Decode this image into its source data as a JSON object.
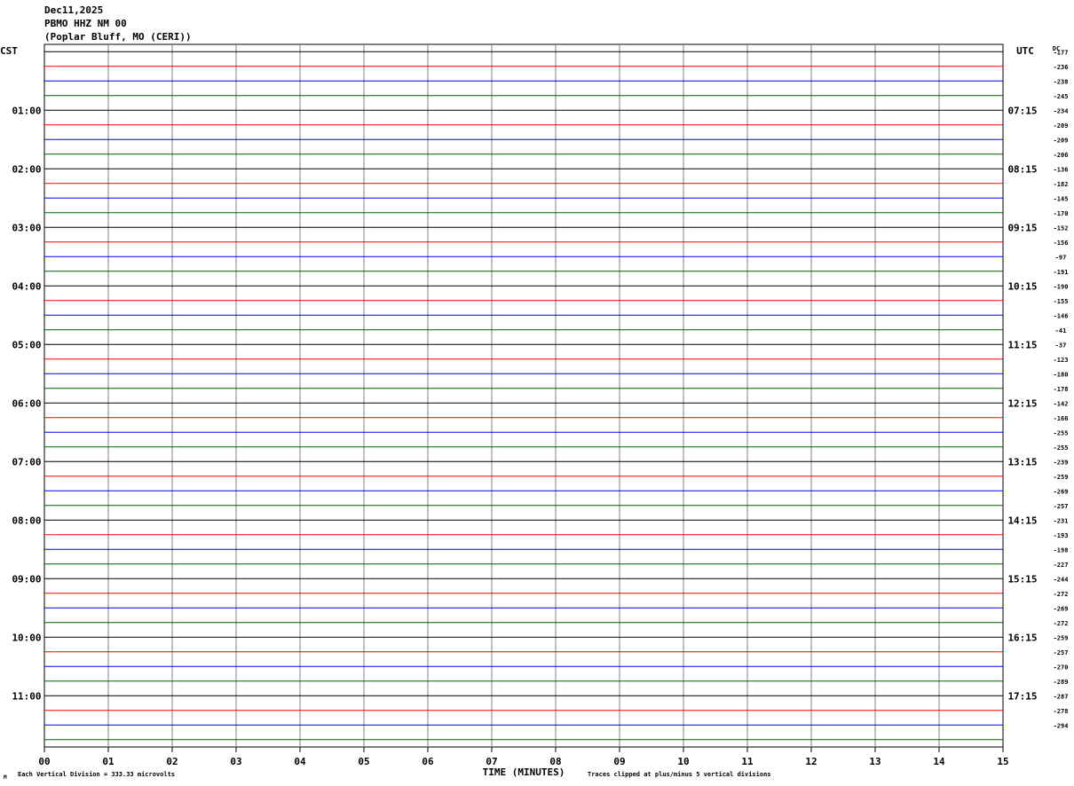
{
  "header": {
    "date": "Dec11,2025",
    "station": "PBMO HHZ NM 00",
    "location": "(Poplar Bluff, MO (CERI))"
  },
  "chart_data": {
    "type": "line",
    "title": "PBMO HHZ NM 00",
    "left_axis_title": "CST",
    "right_axis_title": "UTC",
    "dc_label": "DC",
    "xlabel": "TIME (MINUTES)",
    "x_ticks": [
      "00",
      "01",
      "02",
      "03",
      "04",
      "05",
      "06",
      "07",
      "08",
      "09",
      "10",
      "11",
      "12",
      "13",
      "14",
      "15"
    ],
    "xlim": [
      0,
      15
    ],
    "trace_count": 48,
    "trace_minutes": 15,
    "left_hour_labels": [
      "01:00",
      "02:00",
      "03:00",
      "04:00",
      "05:00",
      "06:00",
      "07:00",
      "08:00",
      "09:00",
      "10:00",
      "11:00"
    ],
    "right_hour_labels": [
      "07:15",
      "08:15",
      "09:15",
      "10:15",
      "11:15",
      "12:15",
      "13:15",
      "14:15",
      "15:15",
      "16:15",
      "17:15"
    ],
    "dc_offsets": [
      "-177",
      "-236",
      "-238",
      "-245",
      "-234",
      "-209",
      "-209",
      "-206",
      "-136",
      "-182",
      "-145",
      "-170",
      "-152",
      "-156",
      "-97",
      "-191",
      "-190",
      "-155",
      "-146",
      "-41",
      "-37",
      "-123",
      "-180",
      "-178",
      "-142",
      "-166",
      "-255",
      "-255",
      "-239",
      "-259",
      "-269",
      "-257",
      "-231",
      "-193",
      "-198",
      "-227",
      "-244",
      "-272",
      "-269",
      "-272",
      "-259",
      "-257",
      "-270",
      "-289",
      "-287",
      "-278",
      "-294"
    ],
    "trace_colors": [
      "#000000",
      "#ff0000",
      "#0000ff",
      "#006400"
    ],
    "footer_left": "Each Vertical Division =  333.33 microvolts",
    "footer_right": "Traces clipped at plus/minus 5 vertical divisions",
    "corner_mark": "M"
  }
}
